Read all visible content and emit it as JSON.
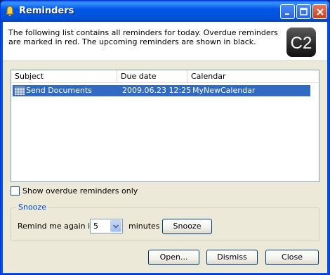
{
  "window": {
    "title": "Reminders"
  },
  "header": {
    "description": "The following list contains all reminders for today. Overdue reminders are marked in red. The upcoming reminders are shown in black.",
    "logo_text": "C2"
  },
  "list": {
    "columns": [
      "Subject",
      "Due date",
      "Calendar"
    ],
    "rows": [
      {
        "subject": "Send Documents",
        "due_date": "2009.06.23 12:25",
        "calendar": "MyNewCalendar",
        "selected": true
      }
    ]
  },
  "overdue_only": {
    "label": "Show overdue reminders only",
    "checked": false
  },
  "snooze": {
    "group_title": "Snooze",
    "remind_label": "Remind me again in",
    "value": "5",
    "unit_label": "minutes",
    "button_label": "Snooze"
  },
  "buttons": {
    "open": "Open...",
    "dismiss": "Dismiss",
    "close": "Close"
  },
  "colors": {
    "selection": "#316ac5",
    "titlebar": "#0058e6",
    "group_title": "#0046d5"
  }
}
